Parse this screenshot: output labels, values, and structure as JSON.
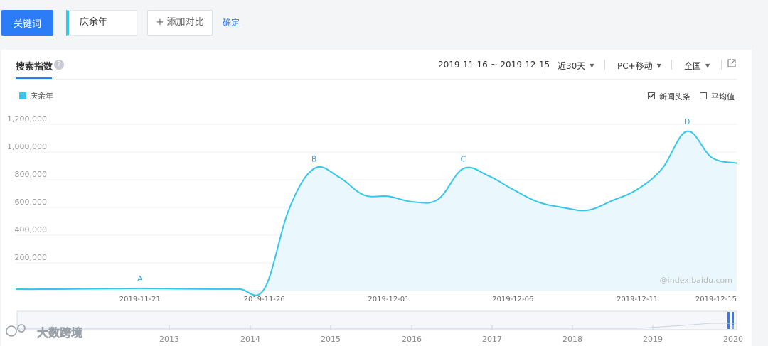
{
  "toolbar": {
    "keyword_button": "关键词",
    "keyword_value": "庆余年",
    "add_compare": "+ 添加对比",
    "confirm": "确定"
  },
  "panel": {
    "tab_title": "搜索指数",
    "help_glyph": "?",
    "date_range": "2019-11-16 ~ 2019-12-15",
    "period": "近30天",
    "device": "PC+移动",
    "region": "全国",
    "legend_label": "庆余年",
    "news_label": "新闻头条",
    "average_label": "平均值",
    "news_checked": true,
    "average_checked": false,
    "watermark": "@index.baidu.com",
    "corner_watermark": "大数跨境"
  },
  "colors": {
    "accent": "#2b7cf6",
    "series": "#36c6e8",
    "area": "#eaf8fd"
  },
  "chart_data": {
    "type": "area",
    "title": "",
    "xlabel": "",
    "ylabel": "",
    "ylim": [
      0,
      1200000
    ],
    "y_ticks": [
      "200,000",
      "400,000",
      "600,000",
      "800,000",
      "1,000,000",
      "1,200,000"
    ],
    "x": [
      "2019-11-16",
      "2019-11-17",
      "2019-11-18",
      "2019-11-19",
      "2019-11-20",
      "2019-11-21",
      "2019-11-22",
      "2019-11-23",
      "2019-11-24",
      "2019-11-25",
      "2019-11-26",
      "2019-11-27",
      "2019-11-28",
      "2019-11-29",
      "2019-11-30",
      "2019-12-01",
      "2019-12-02",
      "2019-12-03",
      "2019-12-04",
      "2019-12-05",
      "2019-12-06",
      "2019-12-07",
      "2019-12-08",
      "2019-12-09",
      "2019-12-10",
      "2019-12-11",
      "2019-12-12",
      "2019-12-13",
      "2019-12-14",
      "2019-12-15"
    ],
    "x_tick_labels": [
      "2019-11-21",
      "2019-11-26",
      "2019-12-01",
      "2019-12-06",
      "2019-12-11",
      "2019-12-15"
    ],
    "x_tick_index": [
      5,
      10,
      15,
      20,
      25,
      29
    ],
    "series": [
      {
        "name": "庆余年",
        "values": [
          10000,
          10000,
          11000,
          13000,
          14000,
          16000,
          14000,
          12000,
          11000,
          11000,
          12000,
          590000,
          880000,
          820000,
          690000,
          680000,
          640000,
          660000,
          880000,
          830000,
          730000,
          640000,
          600000,
          580000,
          650000,
          730000,
          880000,
          1150000,
          960000,
          920000
        ]
      }
    ],
    "annotations": [
      {
        "label": "A",
        "index": 5
      },
      {
        "label": "B",
        "index": 12
      },
      {
        "label": "C",
        "index": 18
      },
      {
        "label": "D",
        "index": 27
      }
    ],
    "grid": true,
    "legend": "top-left"
  },
  "range_slider": {
    "years": [
      "2013",
      "2014",
      "2015",
      "2016",
      "2017",
      "2018",
      "2019",
      "2020"
    ]
  }
}
